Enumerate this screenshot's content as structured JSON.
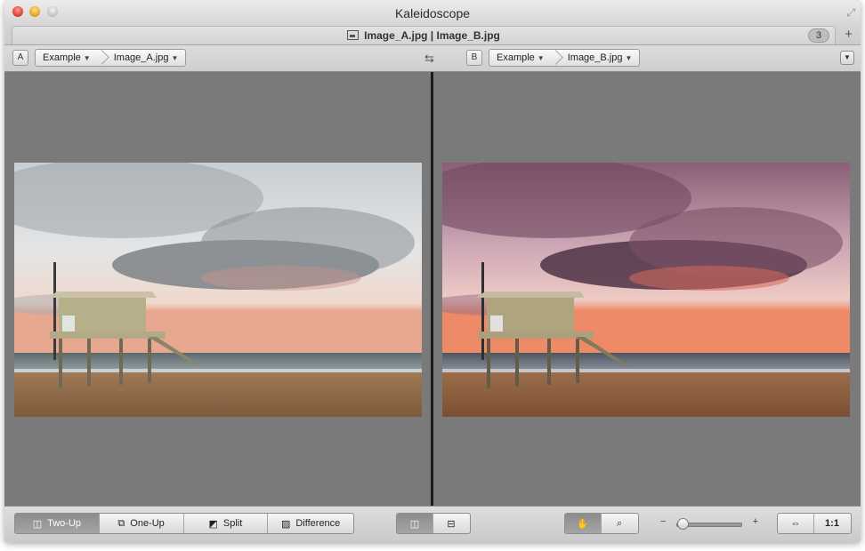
{
  "window": {
    "title": "Kaleidoscope"
  },
  "tab": {
    "title": "Image_A.jpg | Image_B.jpg",
    "count": "3",
    "add_label": "+"
  },
  "left_pane": {
    "badge": "A",
    "crumbs": [
      {
        "label": "Example"
      },
      {
        "label": "Image_A.jpg"
      }
    ]
  },
  "right_pane": {
    "badge": "B",
    "crumbs": [
      {
        "label": "Example"
      },
      {
        "label": "Image_B.jpg"
      }
    ]
  },
  "modes": [
    {
      "label": "Two-Up",
      "selected": true
    },
    {
      "label": "One-Up",
      "selected": false
    },
    {
      "label": "Split",
      "selected": false
    },
    {
      "label": "Difference",
      "selected": false
    }
  ],
  "zoom": {
    "minus": "−",
    "plus": "+",
    "actual_size_label": "1:1",
    "level_fraction": 0.08
  },
  "colors": {
    "image_a_sky_top": "#d8dcde",
    "image_a_cloud": "#7f8388",
    "image_a_horizon": "#e8b29c",
    "image_b_sky_top": "#9b6f85",
    "image_b_cloud": "#5e4356",
    "image_b_horizon": "#ee8d6d",
    "sand": "#a8805a"
  }
}
